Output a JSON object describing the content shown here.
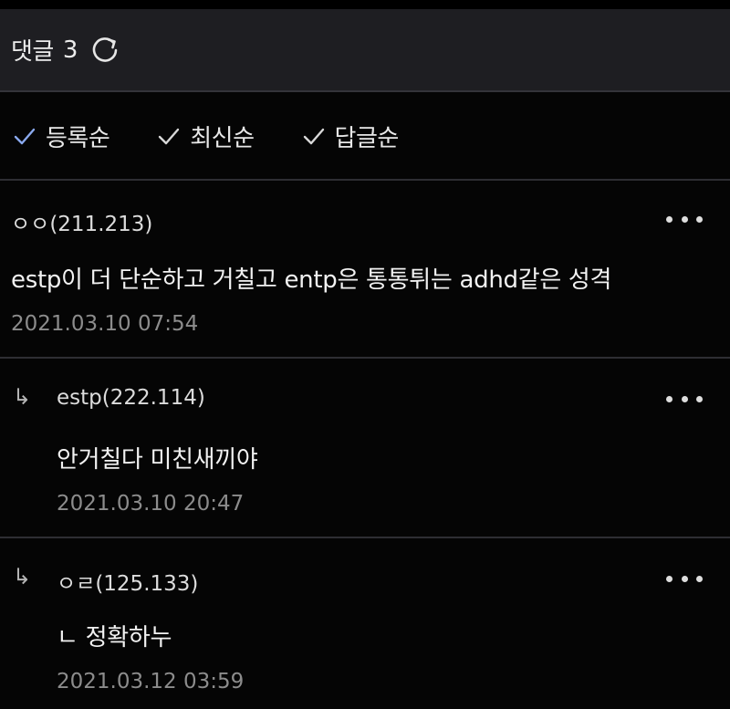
{
  "header": {
    "title": "댓글",
    "count": "3"
  },
  "sort_options": [
    {
      "label": "등록순",
      "active": true
    },
    {
      "label": "최신순",
      "active": false
    },
    {
      "label": "답글순",
      "active": false
    }
  ],
  "colors": {
    "active_check": "#8aa9ee",
    "inactive_check": "#d8d8d8",
    "header_bg": "#1e1e22",
    "bg": "#050505"
  },
  "icons": {
    "refresh": "refresh-icon",
    "check": "check-icon",
    "more": "more-icon",
    "reply": "reply-arrow-icon"
  },
  "comments": [
    {
      "author": "ㅇㅇ(211.213)",
      "text": "estp이 더 단순하고 거칠고 entp은 통통튀는 adhd같은 성격",
      "time": "2021.03.10 07:54"
    },
    {
      "reply_marker": "↳",
      "author": "estp(222.114)",
      "text": "안거칠다 미친새끼야",
      "time": "2021.03.10 20:47"
    },
    {
      "reply_marker": "↳",
      "author": "ㅇㄹ(125.133)",
      "text": "ㄴ 정확하누",
      "time": "2021.03.12 03:59"
    }
  ]
}
